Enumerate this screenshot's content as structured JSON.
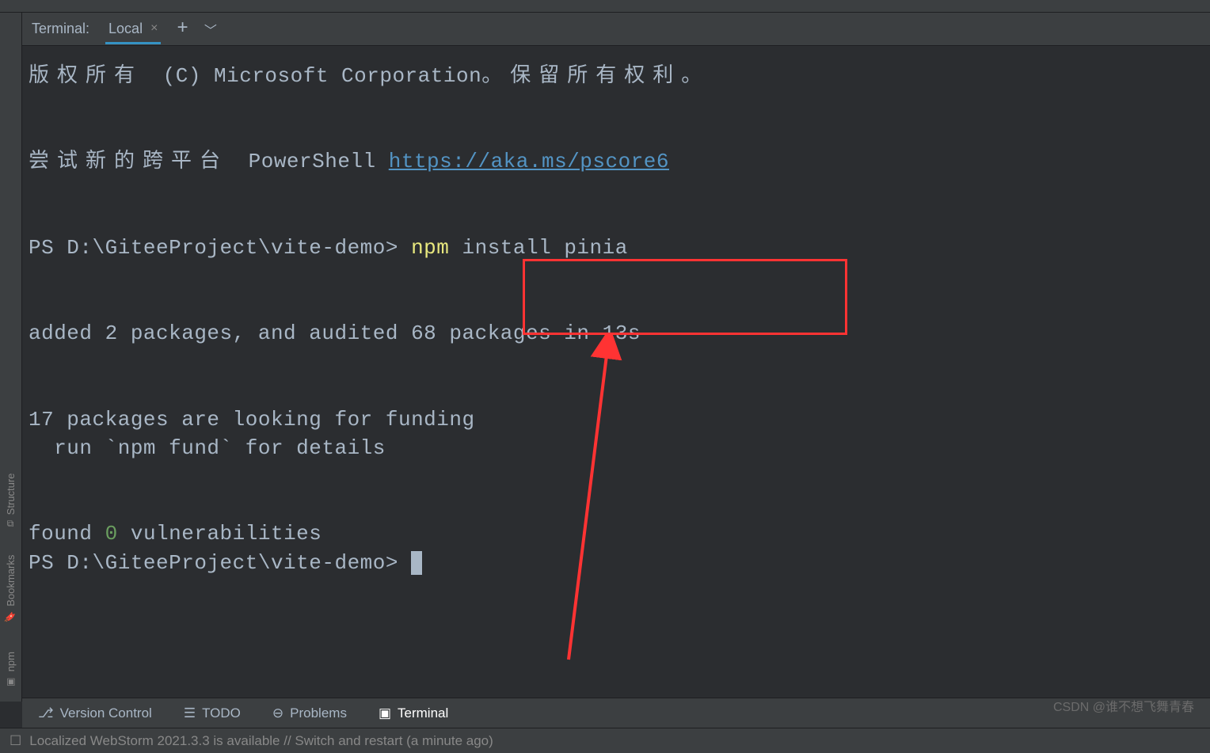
{
  "tabs": {
    "label": "Terminal:",
    "active": "Local"
  },
  "sidebar": {
    "structure": "Structure",
    "bookmarks": "Bookmarks",
    "npm": "npm"
  },
  "terminal": {
    "line1_prefix": "版权所有 ",
    "line1_mid": "(C) Microsoft Corporation",
    "line1_suffix": "。保留所有权利。",
    "line2_prefix": "尝试新的跨平台 ",
    "line2_mid": "PowerShell ",
    "link": "https://aka.ms/pscore6",
    "prompt1": "PS D:\\GiteeProject\\vite-demo> ",
    "cmd_npm": "npm",
    "cmd_rest": " install pinia",
    "added": "added 2 packages, and audited 68 packages in 13s",
    "funding1": "17 packages are looking for funding",
    "funding2": "  run `npm fund` for details",
    "found_pre": "found ",
    "found_zero": "0",
    "found_post": " vulnerabilities",
    "prompt2": "PS D:\\GiteeProject\\vite-demo> "
  },
  "bottom": {
    "vcs": "Version Control",
    "todo": "TODO",
    "problems": "Problems",
    "terminal": "Terminal"
  },
  "status": {
    "text": "Localized WebStorm 2021.3.3 is available // Switch and restart (a minute ago)"
  },
  "watermark": "CSDN @谁不想飞舞青春"
}
